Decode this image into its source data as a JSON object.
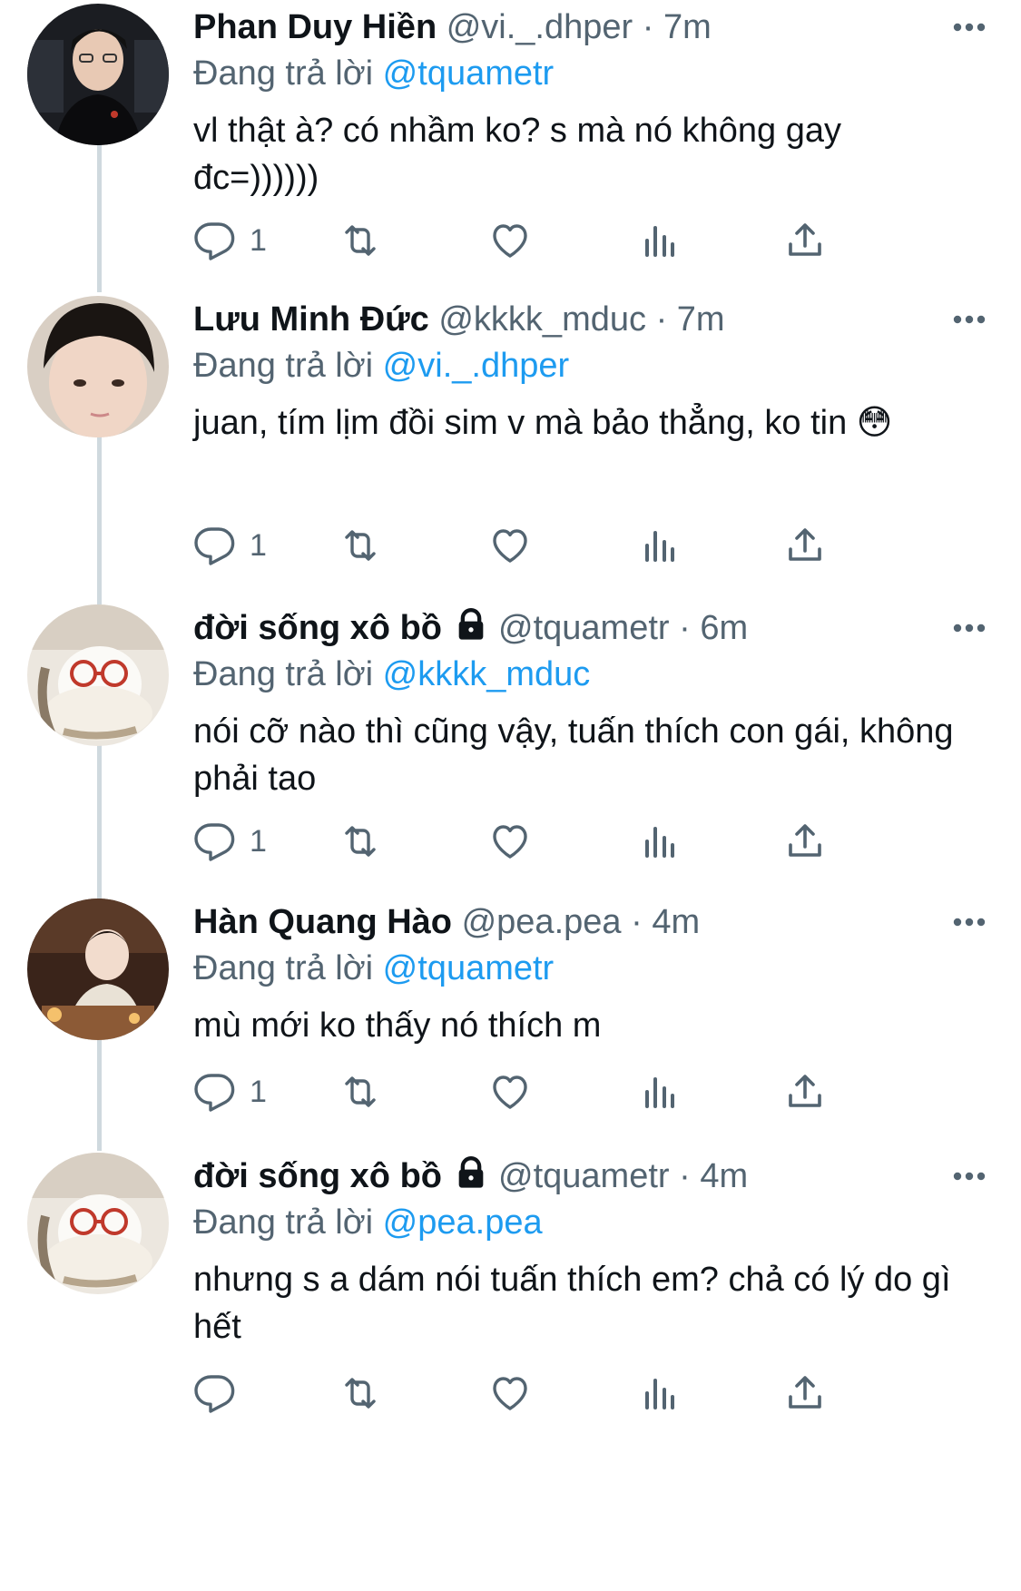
{
  "tweets": [
    {
      "display_name": "Phan Duy Hiền",
      "handle": "@vi._.dhper",
      "dot": "·",
      "time": "7m",
      "locked": false,
      "reply_prefix": "Đang trả lời",
      "reply_to": "@tquametr",
      "text": "vl thật à? có nhầm ko? s mà nó không gay đc=))))))",
      "reply_count": "1"
    },
    {
      "display_name": "Lưu Minh Đức",
      "handle": "@kkkk_mduc",
      "dot": "·",
      "time": "7m",
      "locked": false,
      "reply_prefix": "Đang trả lời",
      "reply_to": "@vi._.dhper",
      "text": "juan, tím lịm đồi sim v mà bảo thẳng, ko tin 😳",
      "reply_count": "1"
    },
    {
      "display_name": "đời sống xô bồ",
      "handle": "@tquametr",
      "dot": "·",
      "time": "6m",
      "locked": true,
      "reply_prefix": "Đang trả lời",
      "reply_to": "@kkkk_mduc",
      "text": "nói cỡ nào thì cũng vậy, tuấn thích con gái, không phải tao",
      "reply_count": "1"
    },
    {
      "display_name": "Hàn Quang Hào",
      "handle": "@pea.pea",
      "dot": "·",
      "time": "4m",
      "locked": false,
      "reply_prefix": "Đang trả lời",
      "reply_to": "@tquametr",
      "text": "mù mới ko thấy nó thích m",
      "reply_count": "1"
    },
    {
      "display_name": "đời sống xô bồ",
      "handle": "@tquametr",
      "dot": "·",
      "time": "4m",
      "locked": true,
      "reply_prefix": "Đang trả lời",
      "reply_to": "@pea.pea",
      "text": "nhưng s a dám nói tuấn thích em? chả có lý do gì hết",
      "reply_count": ""
    }
  ],
  "icons": {
    "reply": "reply-icon",
    "retweet": "retweet-icon",
    "like": "like-icon",
    "views": "views-icon",
    "share": "share-icon",
    "more": "more-icon",
    "lock": "lock-icon"
  },
  "colors": {
    "link": "#1d9bf0",
    "secondary_text": "#536471",
    "thread_line": "#cfd9de"
  }
}
